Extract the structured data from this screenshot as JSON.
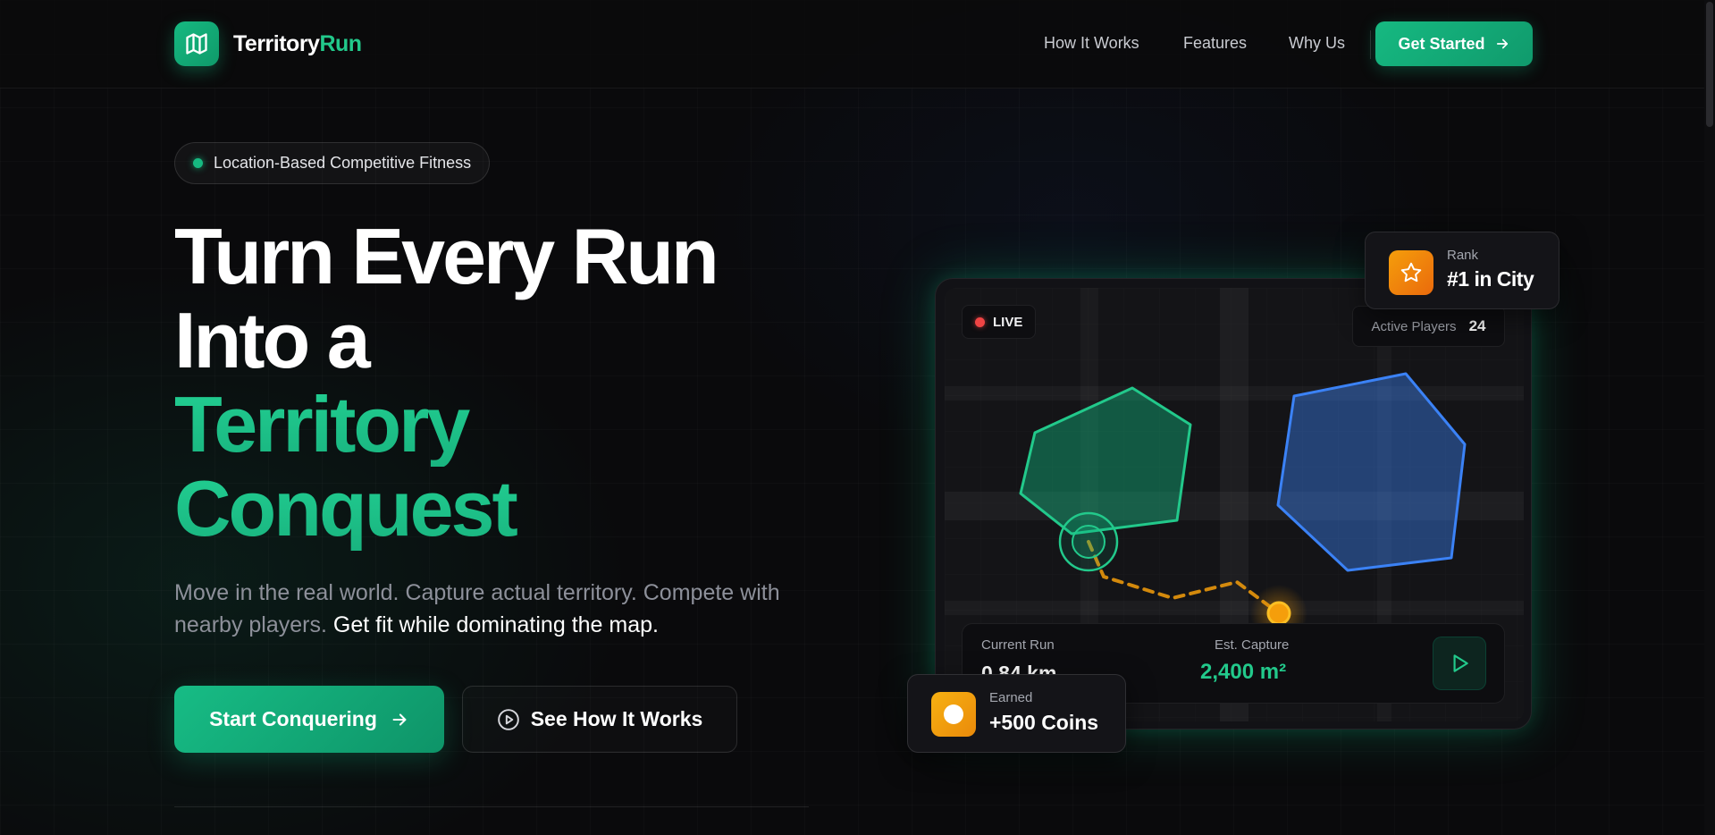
{
  "brand": {
    "name_part1": "Territory",
    "name_part2": "Run",
    "logo_icon": "map-icon"
  },
  "nav": {
    "links": [
      "How It Works",
      "Features",
      "Why Us"
    ],
    "cta_label": "Get Started"
  },
  "hero": {
    "badge": "Location-Based Competitive Fitness",
    "headline_line1": "Turn Every Run",
    "headline_line2": "Into a",
    "headline_line3": "Territory",
    "headline_line4": "Conquest",
    "subtitle_muted": "Move in the real world. Capture actual territory. Compete with nearby players.",
    "subtitle_highlight": "Get fit while dominating the map.",
    "primary_cta": "Start Conquering",
    "secondary_cta": "See How It Works"
  },
  "map": {
    "live_label": "LIVE",
    "active_players_label": "Active Players",
    "active_players_value": "24",
    "rank_label": "Rank",
    "rank_value": "#1 in City",
    "current_run_label": "Current Run",
    "current_run_value": "0.84 km",
    "est_capture_label": "Est. Capture",
    "est_capture_value": "2,400 m²",
    "earned_label": "Earned",
    "earned_value": "+500 Coins"
  },
  "colors": {
    "accent_green": "#16b981",
    "territory_blue": "#3b82f6",
    "route_orange": "#f59e0b",
    "live_red": "#ef4444",
    "background": "#0a0a0c"
  }
}
